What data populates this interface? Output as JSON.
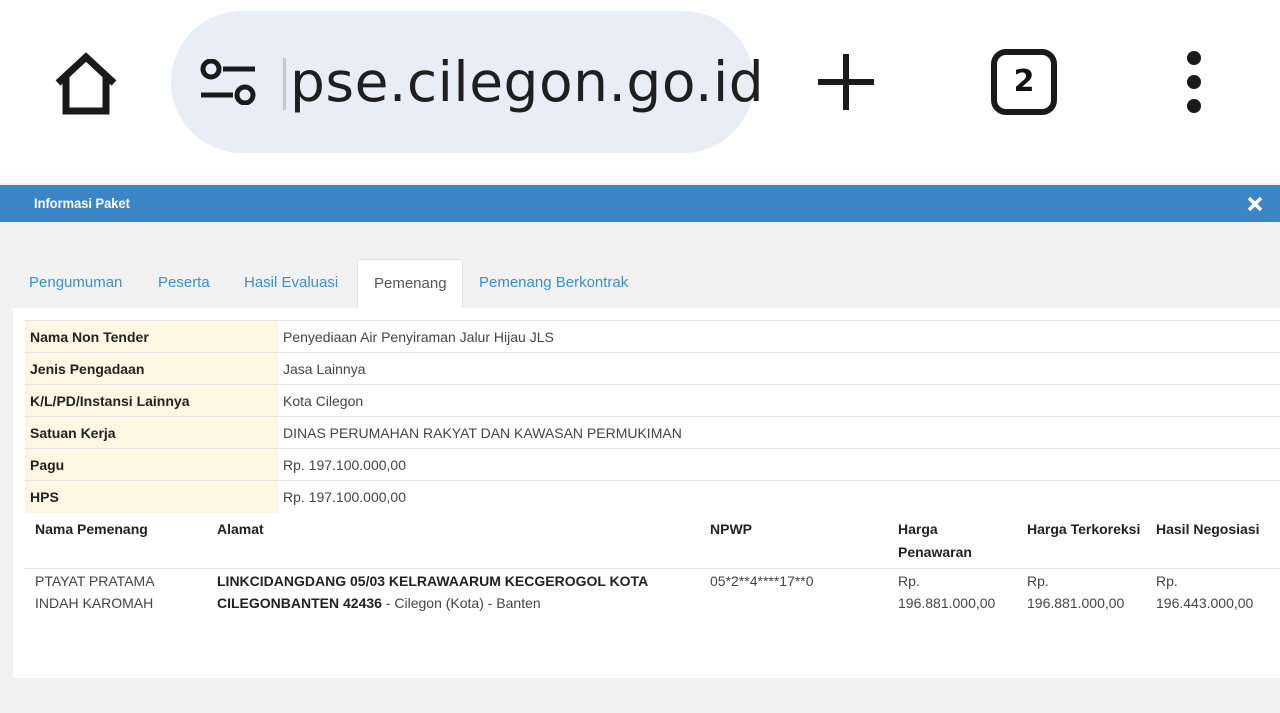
{
  "browser": {
    "url": "pse.cilegon.go.id",
    "tab_count": "2",
    "icons": [
      "home-icon",
      "tune-icon",
      "plus-icon",
      "tab-switcher-icon",
      "more-vert-icon"
    ]
  },
  "dialog": {
    "title": "Informasi Paket",
    "close_icon": "close-icon"
  },
  "tabs": [
    {
      "label": "Pengumuman"
    },
    {
      "label": "Peserta"
    },
    {
      "label": "Hasil Evaluasi"
    },
    {
      "label": "Pemenang",
      "active": true
    },
    {
      "label": "Pemenang Berkontrak"
    }
  ],
  "info": {
    "nama_label": "Nama Non Tender",
    "nama_value": "Penyediaan Air Penyiraman Jalur Hijau JLS",
    "jenis_label": "Jenis Pengadaan",
    "jenis_value": "Jasa Lainnya",
    "instansi_label": "K/L/PD/Instansi Lainnya",
    "instansi_value": "Kota Cilegon",
    "satker_label": "Satuan Kerja",
    "satker_value": "DINAS PERUMAHAN RAKYAT DAN KAWASAN PERMUKIMAN",
    "pagu_label": "Pagu",
    "pagu_value": "Rp. 197.100.000,00",
    "hps_label": "HPS",
    "hps_value": "Rp. 197.100.000,00"
  },
  "winner": {
    "headers": {
      "nama": "Nama Pemenang",
      "alamat": "Alamat",
      "npwp": "NPWP",
      "harga_penawaran_1": "Harga",
      "harga_penawaran_2": "Penawaran",
      "harga_terkoreksi": "Harga Terkoreksi",
      "hasil_negosiasi": "Hasil Negosiasi"
    },
    "row": {
      "nama_1": "PTAYAT PRATAMA",
      "nama_2": "INDAH KAROMAH",
      "alamat_1": "LINKCIDANGDANG 05/03 KELRAWAARUM KECGEROGOL KOTA",
      "alamat_2_bold": "CILEGONBANTEN 42436",
      "alamat_2_rest": " - Cilegon (Kota) - Banten",
      "npwp": "05*2**4****17**0",
      "penawaran_1": "Rp.",
      "penawaran_2": "196.881.000,00",
      "terkoreksi_1": "Rp.",
      "terkoreksi_2": "196.881.000,00",
      "negosiasi_1": "Rp.",
      "negosiasi_2": "196.443.000,00"
    }
  },
  "colors": {
    "titlebar": "#3d86c6",
    "tab_link": "#3a8fd0",
    "label_bg": "#fcf7e3",
    "urlbar_bg": "#e8edf6"
  }
}
